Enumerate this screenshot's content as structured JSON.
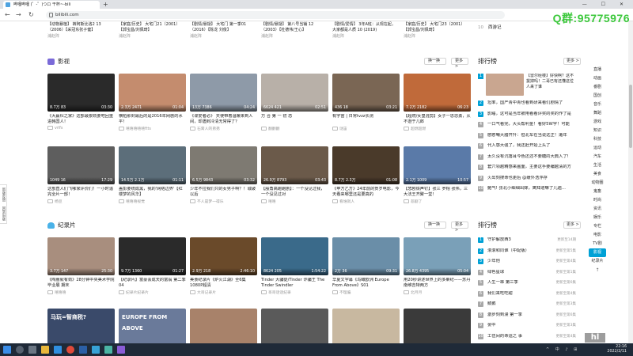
{
  "browser": {
    "tab_title": "哔哩哔哩 (゜-゜)つロ 干杯~-bili",
    "url": "bilibili.com",
    "window_controls": "— ☐ ✕",
    "watermark": "Q群:95775976"
  },
  "top_row": {
    "items": [
      {
        "title": "【动物暴植】 裤阿斯比洛2 13（2006）【采冠东张子健】",
        "meta": "浦赵阵"
      },
      {
        "title": "【家庭/历史】 大宅门21（2001）【郭宝昌/刘佩琦】",
        "meta": "浦赵阵"
      },
      {
        "title": "【剧情/悬疑】 大宅门 第一季01（2016）【陈龙 刘俊】",
        "meta": "浦赵阵"
      },
      {
        "title": "【剧情/悬疑】 第八号当铺 12（2003）【杜德伟/王心】",
        "meta": "浦赵阵"
      },
      {
        "title": "【剧情/爱情】 3年A班：从现在起，大家都是人质 10 (2019)",
        "meta": "浦赵阵"
      },
      {
        "title": "【家庭/历史】 大宅门23（2001）【郭宝昌/刘佩琦】",
        "meta": "浦赵阵"
      }
    ],
    "rank_last": {
      "num": "10",
      "text": "西游记"
    }
  },
  "sections": [
    {
      "title": "影视",
      "refresh_label": "换一换",
      "more_label": "更多 >",
      "cards": [
        {
          "plays": "8.7万",
          "likes": "83",
          "dur": "03:30",
          "title": "《大赢伙之家》这部最狠劲要吧回重进韩国人！",
          "author": "vrlfs"
        },
        {
          "plays": "2.3万",
          "likes": "2471",
          "dur": "01:04",
          "title": "横柏那封最后的是2016年网剧的水平！",
          "author": "嘻嘻嘻嘻嘻ftts"
        },
        {
          "plays": "13万",
          "likes": "7386",
          "dur": "04:24",
          "title": "《谍爱者必》 天使带着温暖来到人间，却遇到冷清无常得了？",
          "author": "石膏人的弟弟"
        },
        {
          "plays": "6624",
          "likes": "421",
          "dur": "02:51",
          "title": "万 合 第 一 初 态",
          "author": "翻翻翻"
        },
        {
          "plays": "436",
          "likes": "18",
          "dur": "03:21",
          "title": "有宇宙 | 日常tvzz长测",
          "author": "谜宙"
        },
        {
          "plays": "7.2万",
          "likes": "2182",
          "dur": "06:23",
          "title": "【超燃/女皇混剪】女子一思思勇，从不逊于儿郎",
          "author": "超燃超燃"
        },
        {
          "plays": "1049",
          "likes": "16",
          "dur": "17:29",
          "title": "这部直人们飞哪家评价们！一小时追完全片一部！",
          "author": "杨豆"
        },
        {
          "plays": "14.5万",
          "likes": "2.1万",
          "dur": "01:11",
          "title": "盖彭要统成黑，我的'网络边界'【红楼梦的风华】",
          "author": "嘻嘻嘻视觉"
        },
        {
          "plays": "6.5万",
          "likes": "9843",
          "dur": "03:32",
          "title": "少年不拉我们只的女男子啊？！城破以后",
          "author": "不人是梦一得乐"
        },
        {
          "plays": "26.9万",
          "likes": "8793",
          "dur": "03:43",
          "title": "【殷角高跑跑剧】：一个没见过我，一个没见过对",
          "author": "嘻嘻"
        },
        {
          "plays": "8.7万",
          "likes": "2.3万",
          "dur": "01:08",
          "title": "《甲方乙方》24年前的贺岁电影，今天看来哪里还是要真的",
          "author": "看谁就人"
        },
        {
          "plays": "2.1万",
          "likes": "1009",
          "dur": "10:57",
          "title": "【悲剧铁声钉】张三 罗翔 张伟，三大法王齐聚一堂！",
          "author": "悲剧了"
        }
      ]
    },
    {
      "title": "纪录片",
      "refresh_label": "换一换",
      "more_label": "更多 >",
      "cards": [
        {
          "plays": "3.7万",
          "likes": "147",
          "dur": "25:30",
          "title": "《陶嵩就有劲》28分钟中央美术学院毕业展 期末",
          "author": "嘻嘻嘻"
        },
        {
          "plays": "9.7万",
          "likes": "1360",
          "dur": "01:27",
          "title": "【纪录片】富豪会成天的富翁 第二季 04",
          "author": "纪录片纪录片"
        },
        {
          "plays": "2.9万",
          "likes": "218",
          "dur": "2:46:10",
          "title": "美食纪录片《炉火江湖》全6集1080P超清",
          "author": "大哥记录片"
        },
        {
          "plays": "8624",
          "likes": "205",
          "dur": "1:54:22",
          "title": "Tinder 大骗徒/Tinder 诈骗王 The Tinder Swindler",
          "author": "哥哥话话纪录"
        },
        {
          "plays": "2万",
          "likes": "36",
          "dur": "09:31",
          "title": "华夏文字幕《鸟瞰欧洲 Europe From Above》S01",
          "author": "不理骗"
        },
        {
          "plays": "26.8万",
          "likes": "4395",
          "dur": "05:04",
          "title": "用20秒讲述世界上的多莱纪——苏丹南维吉特两方",
          "author": "北月月"
        }
      ]
    }
  ],
  "third_row_cards": [
    {
      "text": "马玩=智商税?"
    },
    {
      "text": "EUROPE FROM ABOVE"
    },
    {
      "text": ""
    },
    {
      "text": ""
    },
    {
      "text": ""
    },
    {
      "text": ""
    }
  ],
  "rank1": {
    "title": "排行榜",
    "more_label": "更多 >",
    "top_item": {
      "num": "1",
      "text": "【雷尔经楼】好快啊？这不拔掉吗！二哥已有还懂这位人来了谁"
    },
    "items": [
      {
        "num": "2",
        "text": "坦率，国产青中青也看到研来看们剧情了"
      },
      {
        "num": "3",
        "text": "影睡，这可是当年被用看看评奖的奖的作了是"
      },
      {
        "num": "4",
        "text": "一口气看完，大头帮利金！看好5W字！可能"
      },
      {
        "num": "5",
        "text": "憨憨嘲大腊开升：但北车在当说这正！遭年"
      },
      {
        "num": "6",
        "text": "代入感大强了，我还赶开始上头了"
      },
      {
        "num": "7",
        "text": "太久没有沉落耳今色还还不要糖的大典入了!"
      },
      {
        "num": "8",
        "text": "套穴领越精感来画面，主要这手要编越清的方"
      },
      {
        "num": "9",
        "text": "火出刻搜命也更后 @缓外浩浮存"
      },
      {
        "num": "10",
        "text": "鲍气! 张北小细细出嫁，离知道嘛了几遍..."
      }
    ]
  },
  "rank2": {
    "title": "排行榜",
    "more_label": "更多 >",
    "items": [
      {
        "num": "1",
        "text": "守护解放西3",
        "upd": "更新至14期"
      },
      {
        "num": "2",
        "text": "滚滚和同谁（中配版）",
        "upd": "更新至第5集"
      },
      {
        "num": "3",
        "text": "少年他",
        "upd": "更新至第4集"
      },
      {
        "num": "4",
        "text": "绿色星球",
        "upd": "更新至第1集"
      },
      {
        "num": "5",
        "text": "人生一串 第三季",
        "upd": "更新至第6集"
      },
      {
        "num": "6",
        "text": "我们来吃吃甜",
        "upd": "更新至第4集"
      },
      {
        "num": "7",
        "text": "鹅鹅",
        "upd": "更新至第3集"
      },
      {
        "num": "8",
        "text": "激步刻到漫 第一季",
        "upd": "更新至第6集"
      },
      {
        "num": "9",
        "text": "晏中",
        "upd": "更新至第3集"
      },
      {
        "num": "10",
        "text": "工伍间的命运之 事",
        "upd": "更新至第4集"
      }
    ]
  },
  "right_nav": [
    "直播",
    "动画",
    "番剧",
    "国创",
    "音乐",
    "舞蹈",
    "游戏",
    "知识",
    "科技",
    "运动",
    "汽车",
    "生活",
    "美食",
    "动物圈",
    "鬼畜",
    "时尚",
    "资讯",
    "娱乐",
    "专栏",
    "电影",
    "TV剧",
    "影视",
    "纪录片",
    "↑"
  ],
  "right_nav_active": "影视",
  "left_side": [
    "新版反馈",
    "回到旧版"
  ],
  "taskbar": {
    "time": "22:16",
    "date": "2022/2/11",
    "tray": "^ 中 ♪ ⊞"
  },
  "corner_logo": "hl"
}
